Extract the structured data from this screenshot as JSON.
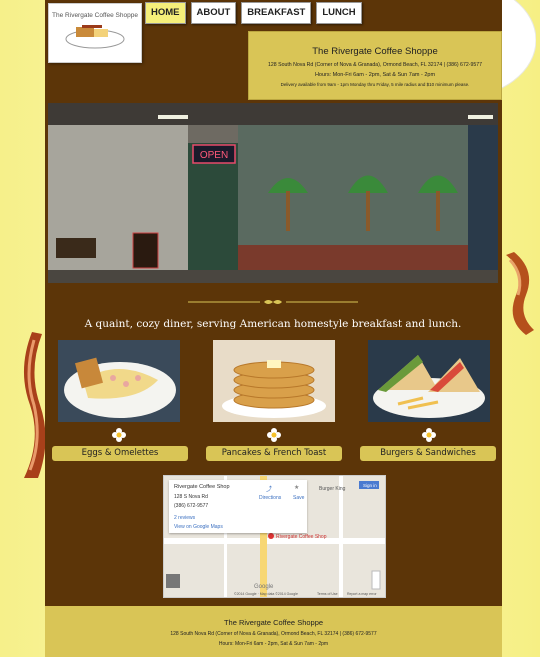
{
  "site": {
    "logo_text": "The Rivergate Coffee Shoppe"
  },
  "nav": [
    {
      "label": "HOME",
      "active": true
    },
    {
      "label": "ABOUT",
      "active": false
    },
    {
      "label": "BREAKFAST",
      "active": false
    },
    {
      "label": "LUNCH",
      "active": false
    }
  ],
  "info": {
    "name": "The Rivergate Coffee Shoppe",
    "address": "128 South Nova Rd (Corner of Nova & Granada), Ormond Beach, FL 32174 | (386) 672-9577",
    "hours": "Hours: Mon-Fri 6am - 2pm, Sat & Sun 7am - 2pm",
    "delivery": "Delivery available from 9am - 1pm Monday thru Friday, 5 mile radius and $10 minimum please."
  },
  "hero": {
    "open_sign": "OPEN"
  },
  "tagline": "A quaint, cozy diner, serving American homestyle breakfast and lunch.",
  "menu": [
    {
      "label": "Eggs & Omelettes"
    },
    {
      "label": "Pancakes & French Toast"
    },
    {
      "label": "Burgers & Sandwiches"
    }
  ],
  "map": {
    "place_name": "Rivergate Coffee Shop",
    "address": "128 S Nova Rd",
    "phone": "(386) 672-9577",
    "reviews": "2 reviews",
    "link": "View on Google Maps",
    "directions": "Directions",
    "save": "Save",
    "signin": "Sign in",
    "pin_label": "Rivergate Coffee Shop",
    "burger_king": "Burger King",
    "copyright": "©2014 Google · Map data ©2014 Google",
    "terms": "Terms of Use",
    "report": "Report a map error"
  },
  "footer": {
    "name": "The Rivergate Coffee Shoppe",
    "address": "128 South Nova Rd (Corner of Nova & Granada), Ormond Beach, FL 32174 | (386) 672-9577",
    "hours": "Hours: Mon-Fri 6am - 2pm, Sat & Sun 7am - 2pm"
  }
}
